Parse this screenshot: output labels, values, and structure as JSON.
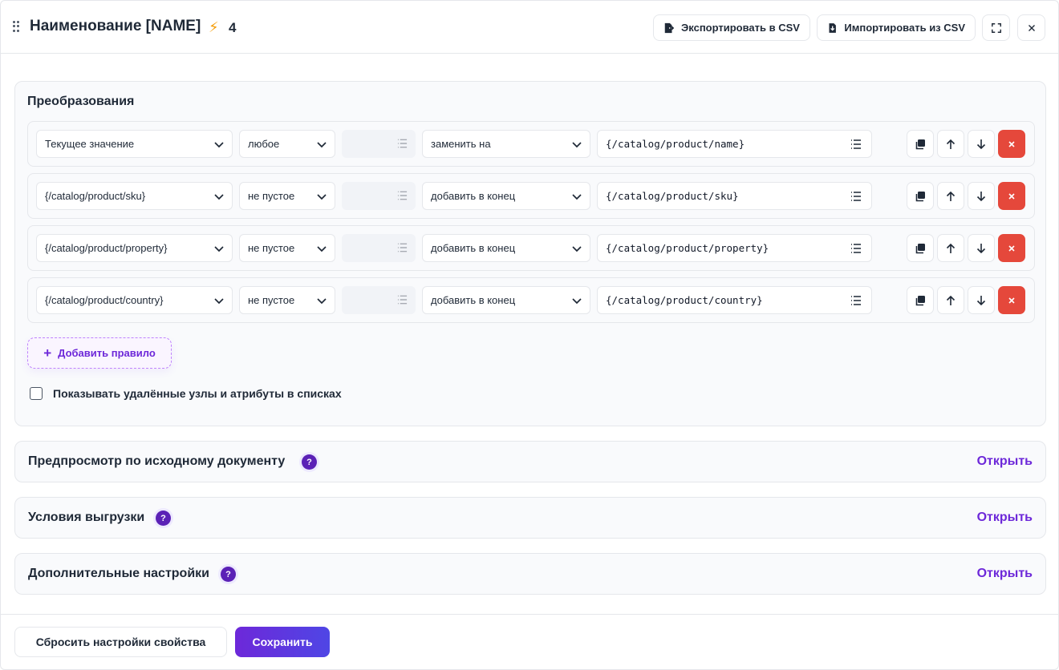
{
  "header": {
    "title": "Наименование [NAME]",
    "badge_count": "4",
    "export_label": "Экспортировать в CSV",
    "import_label": "Импортировать из CSV"
  },
  "transforms": {
    "title": "Преобразования",
    "rules": [
      {
        "source": "Текущее значение",
        "condition": "любое",
        "action": "заменить на",
        "value": "{/catalog/product/name}"
      },
      {
        "source": "{/catalog/product/sku}",
        "condition": "не пустое",
        "action": "добавить в конец",
        "value": "{/catalog/product/sku}"
      },
      {
        "source": "{/catalog/product/property}",
        "condition": "не пустое",
        "action": "добавить в конец",
        "value": "{/catalog/product/property}"
      },
      {
        "source": "{/catalog/product/country}",
        "condition": "не пустое",
        "action": "добавить в конец",
        "value": "{/catalog/product/country}"
      }
    ],
    "add_rule_label": "Добавить правило",
    "show_deleted_label": "Показывать удалённые узлы и атрибуты в списках"
  },
  "sections": [
    {
      "title": "Предпросмотр по исходному документу",
      "help": "?",
      "open_label": "Открыть"
    },
    {
      "title": "Условия выгрузки",
      "help": "?",
      "open_label": "Открыть"
    },
    {
      "title": "Дополнительные настройки",
      "help": "?",
      "open_label": "Открыть"
    }
  ],
  "footer": {
    "reset_label": "Сбросить настройки свойства",
    "save_label": "Сохранить"
  },
  "icons": {
    "bolt": "⚡",
    "plus": "+"
  },
  "colors": {
    "accent": "#6d28d9",
    "danger": "#e5483b",
    "bolt": "#f59e0b"
  }
}
